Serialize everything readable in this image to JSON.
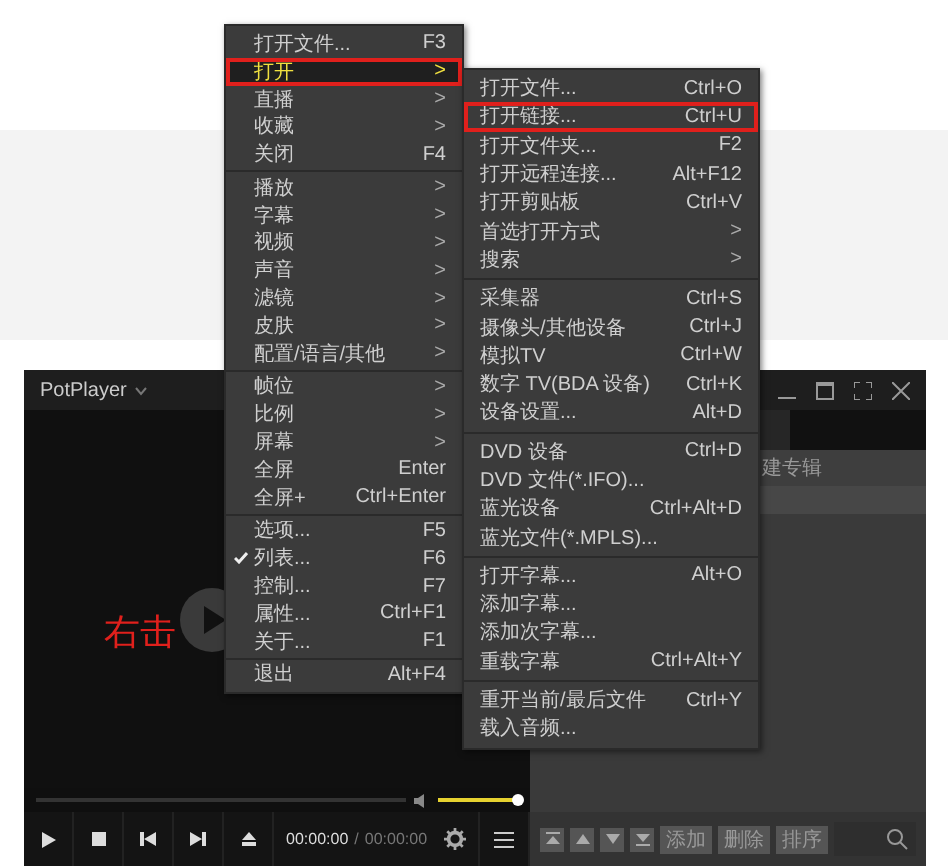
{
  "menu": {
    "items": [
      {
        "kind": "item",
        "label": "打开文件...",
        "shortcut": "F3",
        "selected": false,
        "checked": false,
        "marked": false
      },
      {
        "kind": "item",
        "label": "打开",
        "arrow": ">",
        "selected": true,
        "checked": false,
        "marked": true
      },
      {
        "kind": "item",
        "label": "直播",
        "arrow": ">",
        "selected": false,
        "checked": false,
        "marked": false
      },
      {
        "kind": "item",
        "label": "收藏",
        "arrow": ">",
        "selected": false,
        "checked": false,
        "marked": false
      },
      {
        "kind": "item",
        "label": "关闭",
        "shortcut": "F4",
        "selected": false,
        "checked": false,
        "marked": false
      },
      {
        "kind": "separator"
      },
      {
        "kind": "item",
        "label": "播放",
        "arrow": ">",
        "selected": false,
        "checked": false,
        "marked": false
      },
      {
        "kind": "item",
        "label": "字幕",
        "arrow": ">",
        "selected": false,
        "checked": false,
        "marked": false
      },
      {
        "kind": "item",
        "label": "视频",
        "arrow": ">",
        "selected": false,
        "checked": false,
        "marked": false
      },
      {
        "kind": "item",
        "label": "声音",
        "arrow": ">",
        "selected": false,
        "checked": false,
        "marked": false
      },
      {
        "kind": "item",
        "label": "滤镜",
        "arrow": ">",
        "selected": false,
        "checked": false,
        "marked": false
      },
      {
        "kind": "item",
        "label": "皮肤",
        "arrow": ">",
        "selected": false,
        "checked": false,
        "marked": false
      },
      {
        "kind": "item",
        "label": "配置/语言/其他",
        "arrow": ">",
        "selected": false,
        "checked": false,
        "marked": false
      },
      {
        "kind": "separator"
      },
      {
        "kind": "item",
        "label": "帧位",
        "arrow": ">",
        "selected": false,
        "checked": false,
        "marked": false
      },
      {
        "kind": "item",
        "label": "比例",
        "arrow": ">",
        "selected": false,
        "checked": false,
        "marked": false
      },
      {
        "kind": "item",
        "label": "屏幕",
        "arrow": ">",
        "selected": false,
        "checked": false,
        "marked": false
      },
      {
        "kind": "item",
        "label": "全屏",
        "shortcut": "Enter",
        "selected": false,
        "checked": false,
        "marked": false
      },
      {
        "kind": "item",
        "label": "全屏+",
        "shortcut": "Ctrl+Enter",
        "selected": false,
        "checked": false,
        "marked": false
      },
      {
        "kind": "separator"
      },
      {
        "kind": "item",
        "label": "选项...",
        "shortcut": "F5",
        "selected": false,
        "checked": false,
        "marked": false
      },
      {
        "kind": "item",
        "label": "列表...",
        "shortcut": "F6",
        "selected": false,
        "checked": true,
        "marked": false
      },
      {
        "kind": "item",
        "label": "控制...",
        "shortcut": "F7",
        "selected": false,
        "checked": false,
        "marked": false
      },
      {
        "kind": "item",
        "label": "属性...",
        "shortcut": "Ctrl+F1",
        "selected": false,
        "checked": false,
        "marked": false
      },
      {
        "kind": "item",
        "label": "关于...",
        "shortcut": "F1",
        "selected": false,
        "checked": false,
        "marked": false
      },
      {
        "kind": "separator"
      },
      {
        "kind": "item",
        "label": "退出",
        "shortcut": "Alt+F4",
        "selected": false,
        "checked": false,
        "marked": false
      }
    ]
  },
  "submenu": {
    "items": [
      {
        "kind": "item",
        "label": "打开文件...",
        "shortcut": "Ctrl+O",
        "marked": false
      },
      {
        "kind": "item",
        "label": "打开链接...",
        "shortcut": "Ctrl+U",
        "marked": true
      },
      {
        "kind": "item",
        "label": "打开文件夹...",
        "shortcut": "F2",
        "marked": false
      },
      {
        "kind": "item",
        "label": "打开远程连接...",
        "shortcut": "Alt+F12",
        "marked": false
      },
      {
        "kind": "item",
        "label": "打开剪贴板",
        "shortcut": "Ctrl+V",
        "marked": false
      },
      {
        "kind": "item",
        "label": "首选打开方式",
        "arrow": ">",
        "marked": false
      },
      {
        "kind": "item",
        "label": "搜索",
        "arrow": ">",
        "marked": false
      },
      {
        "kind": "separator"
      },
      {
        "kind": "item",
        "label": "采集器",
        "shortcut": "Ctrl+S",
        "marked": false
      },
      {
        "kind": "item",
        "label": "摄像头/其他设备",
        "shortcut": "Ctrl+J",
        "marked": false
      },
      {
        "kind": "item",
        "label": "模拟TV",
        "shortcut": "Ctrl+W",
        "marked": false
      },
      {
        "kind": "item",
        "label": "数字 TV(BDA 设备)",
        "shortcut": "Ctrl+K",
        "marked": false
      },
      {
        "kind": "item",
        "label": "设备设置...",
        "shortcut": "Alt+D",
        "marked": false
      },
      {
        "kind": "separator"
      },
      {
        "kind": "item",
        "label": "DVD 设备",
        "shortcut": "Ctrl+D",
        "marked": false
      },
      {
        "kind": "item",
        "label": "DVD 文件(*.IFO)...",
        "marked": false
      },
      {
        "kind": "item",
        "label": "蓝光设备",
        "shortcut": "Ctrl+Alt+D",
        "marked": false
      },
      {
        "kind": "item",
        "label": "蓝光文件(*.MPLS)...",
        "marked": false
      },
      {
        "kind": "separator"
      },
      {
        "kind": "item",
        "label": "打开字幕...",
        "shortcut": "Alt+O",
        "marked": false
      },
      {
        "kind": "item",
        "label": "添加字幕...",
        "marked": false
      },
      {
        "kind": "item",
        "label": "添加次字幕...",
        "marked": false
      },
      {
        "kind": "item",
        "label": "重载字幕",
        "shortcut": "Ctrl+Alt+Y",
        "marked": false
      },
      {
        "kind": "separator"
      },
      {
        "kind": "item",
        "label": "重开当前/最后文件",
        "shortcut": "Ctrl+Y",
        "marked": false
      },
      {
        "kind": "item",
        "label": "载入音频...",
        "marked": false
      }
    ]
  },
  "player": {
    "title": "PotPlayer",
    "annotation": "右击",
    "volume": {
      "level": 1.0
    },
    "time_current": "00:00:00",
    "time_separator": "/",
    "time_total": "00:00:00"
  },
  "playlist": {
    "tab_label": "建专辑",
    "buttons": [
      "添加",
      "删除",
      "排序"
    ]
  }
}
